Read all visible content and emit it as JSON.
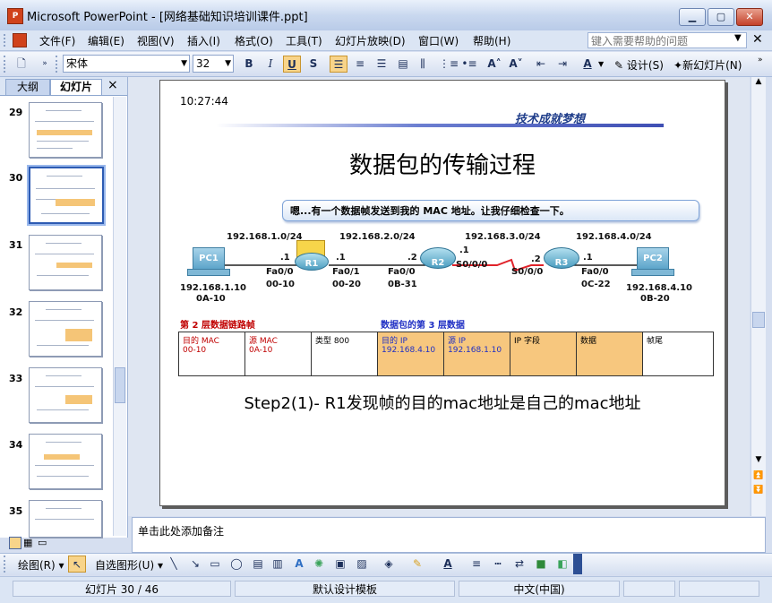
{
  "window": {
    "title": "Microsoft PowerPoint - [网络基础知识培训课件.ppt]",
    "min": "▁",
    "max": "▢",
    "close": "✕"
  },
  "menu": {
    "items": [
      "文件(F)",
      "编辑(E)",
      "视图(V)",
      "插入(I)",
      "格式(O)",
      "工具(T)",
      "幻灯片放映(D)",
      "窗口(W)",
      "帮助(H)"
    ],
    "help_placeholder": "键入需要帮助的问题"
  },
  "toolbar": {
    "font_name": "宋体",
    "font_size": "32",
    "bold": "B",
    "italic": "I",
    "underline": "U",
    "shadow": "S",
    "design_label": "设计(S)",
    "new_slide_label": "新幻灯片(N)"
  },
  "leftpane": {
    "tab_outline": "大纲",
    "tab_slides": "幻灯片",
    "close": "×",
    "thumbs": [
      {
        "num": "29"
      },
      {
        "num": "30"
      },
      {
        "num": "31"
      },
      {
        "num": "32"
      },
      {
        "num": "33"
      },
      {
        "num": "34"
      },
      {
        "num": "35"
      }
    ],
    "selected": "30"
  },
  "slide": {
    "time": "10:27:44",
    "motto": "技术成就梦想",
    "title": "数据包的传输过程",
    "callout": "嗯...有一个数据帧发送到我的 MAC 地址。让我仔细检查一下。",
    "nets": [
      "192.168.1.0/24",
      "192.168.2.0/24",
      "192.168.3.0/24",
      "192.168.4.0/24"
    ],
    "devices": {
      "pc1": "PC1",
      "r1": "R1",
      "r2": "R2",
      "r3": "R3",
      "pc2": "PC2"
    },
    "pc1_ip": "192.168.1.10",
    "pc1_mac": "0A-10",
    "pc2_ip": "192.168.4.10",
    "pc2_mac": "0B-20",
    "r1_fa00": "Fa0/0",
    "r1_fa00_mac": "00-10",
    "r1_fa00_addr": ".1",
    "r1_fa01": "Fa0/1",
    "r1_fa01_mac": "00-20",
    "r1_fa01_addr": ".1",
    "r2_fa00": "Fa0/0",
    "r2_fa00_mac": "0B-31",
    "r2_fa00_addr": ".2",
    "r2_s000": "S0/0/0",
    "r2_s000_addr": ".1",
    "r3_s000": "S0/0/0",
    "r3_s000_addr": ".2",
    "r3_fa00": "Fa0/0",
    "r3_fa00_mac": "0C-22",
    "r3_fa00_addr": ".1",
    "pc1_addr": ".1",
    "legend_l2": "第 2 层数据链路帧",
    "legend_l3": "数据包的第 3 层数据",
    "frame": [
      {
        "label": "目的 MAC",
        "value": "00-10",
        "color": "#c00000",
        "orange": false
      },
      {
        "label": "源 MAC",
        "value": "0A-10",
        "color": "#c00000",
        "orange": false
      },
      {
        "label": "类型 800",
        "value": "",
        "color": "#000000",
        "orange": false
      },
      {
        "label": "目的 IP",
        "value": "192.168.4.10",
        "color": "#1f2fc4",
        "orange": true
      },
      {
        "label": "源 IP",
        "value": "192.168.1.10",
        "color": "#1f2fc4",
        "orange": true
      },
      {
        "label": "IP 字段",
        "value": "",
        "color": "#000000",
        "orange": true
      },
      {
        "label": "数据",
        "value": "",
        "color": "#000000",
        "orange": true
      },
      {
        "label": "帧尾",
        "value": "",
        "color": "#000000",
        "orange": false
      }
    ],
    "step": "Step2(1)- R1发现帧的目的mac地址是自己的mac地址"
  },
  "notes": {
    "placeholder": "单击此处添加备注"
  },
  "drawbar": {
    "draw": "绘图(R)",
    "autoshapes": "自选图形(U)"
  },
  "status": {
    "slide": "幻灯片 30 / 46",
    "template": "默认设计模板",
    "lang": "中文(中国)"
  }
}
